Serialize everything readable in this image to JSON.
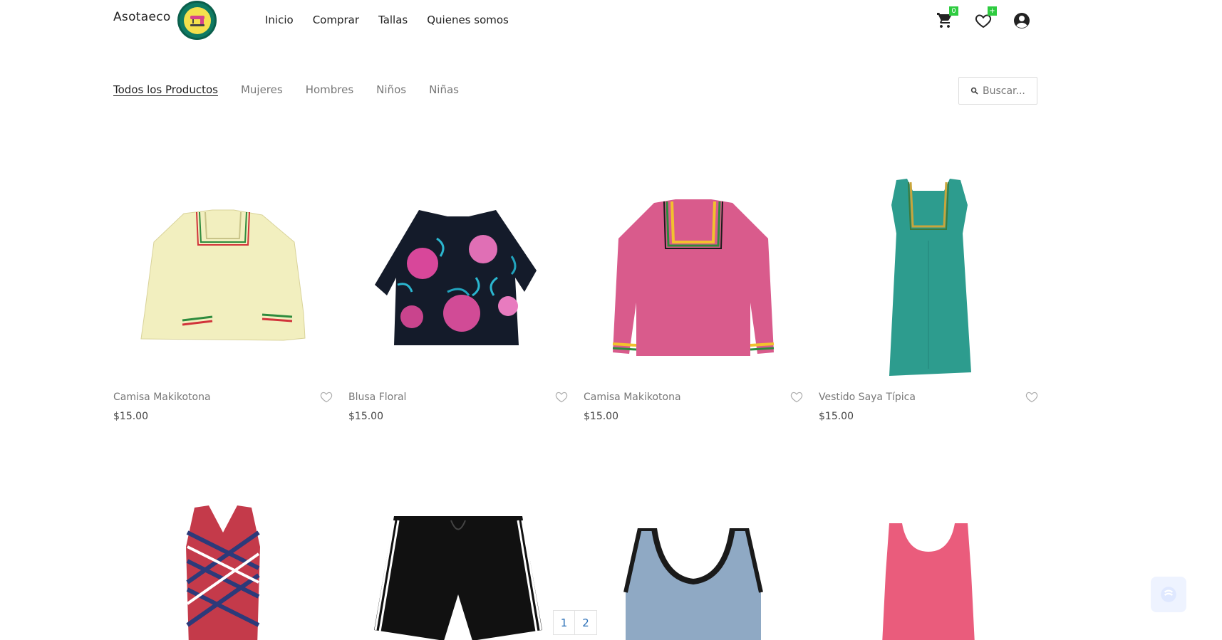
{
  "header": {
    "brand": "Asotaeco",
    "nav": [
      "Inicio",
      "Comprar",
      "Tallas",
      "Quienes somos"
    ],
    "cart_count": "0",
    "wishlist_badge": "+"
  },
  "categories": {
    "items": [
      "Todos los Productos",
      "Mujeres",
      "Hombres",
      "Niños",
      "Niñas"
    ],
    "active": "Todos los Productos"
  },
  "search": {
    "placeholder": "Buscar..."
  },
  "products": [
    {
      "name": "Camisa Makikotona",
      "price": "$15.00"
    },
    {
      "name": "Blusa Floral",
      "price": "$15.00"
    },
    {
      "name": "Camisa Makikotona",
      "price": "$15.00"
    },
    {
      "name": "Vestido Saya Típica",
      "price": "$15.00"
    }
  ],
  "pagination": {
    "pages": [
      "1",
      "2"
    ]
  },
  "colors": {
    "badge": "#2ecc40",
    "link": "#2a6fb7",
    "logo_ring": "#0f7a63",
    "logo_center": "#f4e04d"
  }
}
